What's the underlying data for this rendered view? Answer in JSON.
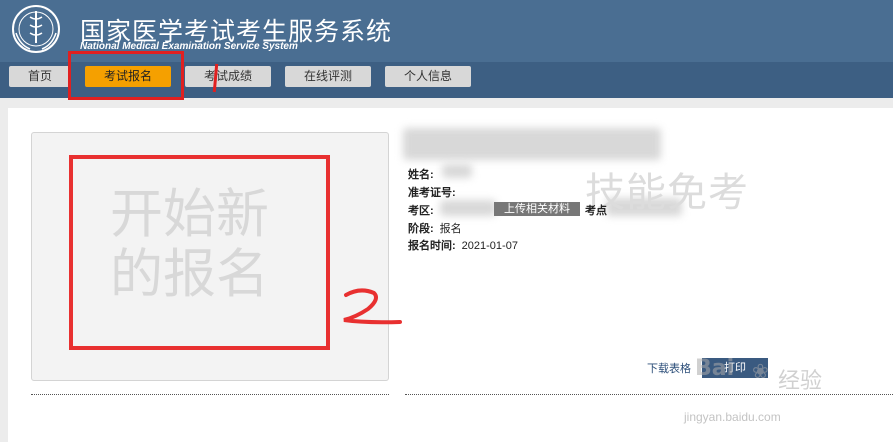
{
  "header": {
    "title": "国家医学考试考生服务系统",
    "subtitle": "National Medical Examination Service System"
  },
  "nav": {
    "items": [
      {
        "label": "首页"
      },
      {
        "label": "考试报名",
        "active": true
      },
      {
        "label": "考试成绩"
      },
      {
        "label": "在线评测"
      },
      {
        "label": "个人信息"
      }
    ]
  },
  "annotations": {
    "mark_1": "1",
    "mark_2": "2"
  },
  "photo": {
    "text_line1": "开始新",
    "text_line2": "的报名"
  },
  "watermark": "技能免考",
  "info": {
    "name_label": "姓名:",
    "ticket_label": "准考证号:",
    "region_label": "考区:",
    "upload_button": "上传相关材料",
    "site_label": "考点",
    "stage_label": "阶段:",
    "stage_value": "报名",
    "time_label": "报名时间:",
    "time_value": "2021-01-07"
  },
  "actions": {
    "download": "下载表格",
    "print": "打印"
  },
  "baidu": {
    "brand": "Bai",
    "brand2": "经验",
    "url": "jingyan.baidu.com"
  },
  "colors": {
    "header_bg": "#4a6e92",
    "navbar_bg": "#3d5f83",
    "active_tab": "#f5a000",
    "annotation_red": "#e02020",
    "print_button": "#3a5a80"
  }
}
